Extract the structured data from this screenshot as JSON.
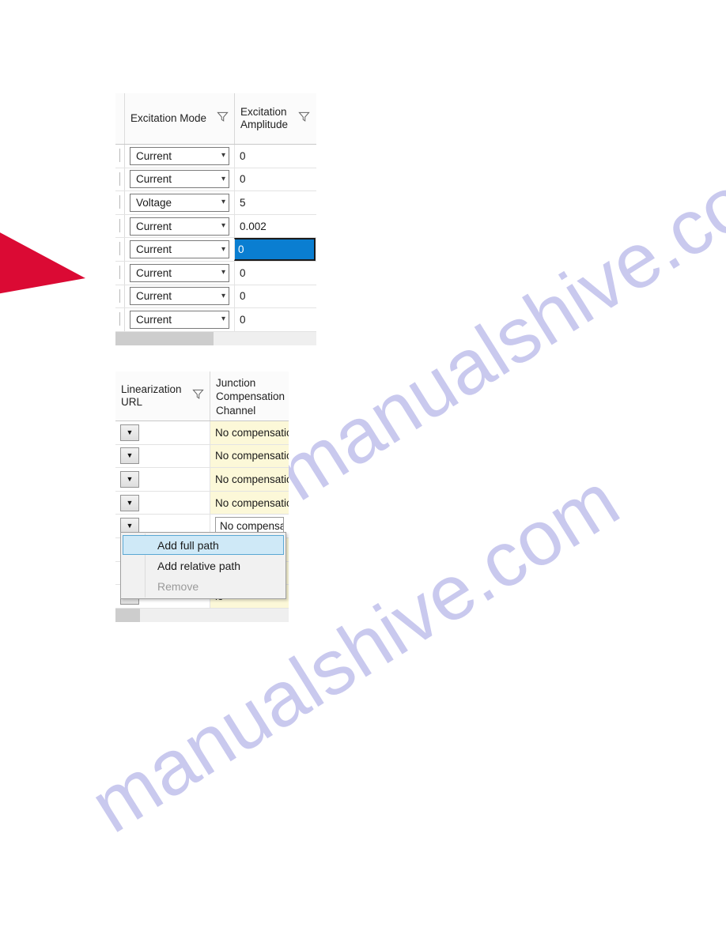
{
  "page": {
    "background": "#ffffff",
    "watermark_text": "manualshive.com",
    "watermark_color": "#c9c9ee",
    "flag_color": "#DB0A34"
  },
  "colors": {
    "selection_blue": "#0a7ed1",
    "menu_highlight": "#cfe9f7",
    "menu_highlight_border": "#5aa8d4",
    "readonly_yellow": "#fcf8d8",
    "header_bg": "#fbfbfb",
    "scroll_thumb": "#cdcdcd"
  },
  "grid_excitation": {
    "name": "Excitation settings grid",
    "columns": [
      {
        "label": "Excitation Mode",
        "filter_icon": "funnel-icon"
      },
      {
        "label": "Excitation Amplitude",
        "filter_icon": "funnel-icon"
      }
    ],
    "rows": [
      {
        "mode": "Current",
        "amplitude": "0",
        "selected": false
      },
      {
        "mode": "Current",
        "amplitude": "0",
        "selected": false
      },
      {
        "mode": "Voltage",
        "amplitude": "5",
        "selected": false
      },
      {
        "mode": "Current",
        "amplitude": "0.002",
        "selected": false
      },
      {
        "mode": "Current",
        "amplitude": "0",
        "selected": true
      },
      {
        "mode": "Current",
        "amplitude": "0",
        "selected": false
      },
      {
        "mode": "Current",
        "amplitude": "0",
        "selected": false
      },
      {
        "mode": "Current",
        "amplitude": "0",
        "selected": false
      }
    ],
    "combo_chevron": "▾",
    "scrollbar": {
      "thumb_left_pct": 0,
      "thumb_width_pct": 49
    }
  },
  "grid_linearization": {
    "name": "Linearization grid",
    "columns": [
      {
        "label": "Linearization URL",
        "filter_icon": "funnel-icon"
      },
      {
        "label": "Junction Compensation Channel",
        "filter_icon": null
      }
    ],
    "dropdown_glyph": "▼",
    "rows": [
      {
        "url": "",
        "compensation": "No compensatio",
        "editing": false
      },
      {
        "url": "",
        "compensation": "No compensatio",
        "editing": false
      },
      {
        "url": "",
        "compensation": "No compensatio",
        "editing": false
      },
      {
        "url": "",
        "compensation": "No compensatio",
        "editing": false
      },
      {
        "url": "",
        "compensation": "No compensat",
        "editing": true
      },
      {
        "url": "",
        "compensation": "io",
        "editing": false
      },
      {
        "url": "",
        "compensation": "io",
        "editing": false
      },
      {
        "url": "",
        "compensation": "io",
        "editing": false
      }
    ],
    "scrollbar": {
      "thumb_left_pct": 0,
      "thumb_width_pct": 14
    }
  },
  "context_menu": {
    "name": "Linearization URL context menu",
    "items": [
      {
        "label": "Add full path",
        "state": "selected"
      },
      {
        "label": "Add relative path",
        "state": "normal"
      },
      {
        "label": "Remove",
        "state": "disabled"
      }
    ]
  }
}
